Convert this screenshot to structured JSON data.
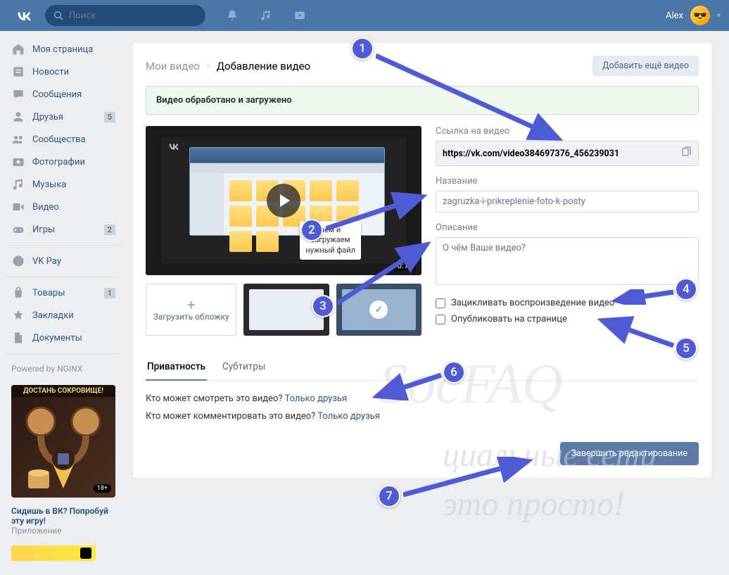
{
  "topbar": {
    "search_placeholder": "Поиск",
    "user": "Alex"
  },
  "nav": [
    {
      "icon": "home",
      "label": "Моя страница",
      "badge": ""
    },
    {
      "icon": "news",
      "label": "Новости",
      "badge": ""
    },
    {
      "icon": "msg",
      "label": "Сообщения",
      "badge": ""
    },
    {
      "icon": "friends",
      "label": "Друзья",
      "badge": "5"
    },
    {
      "icon": "groups",
      "label": "Сообщества",
      "badge": ""
    },
    {
      "icon": "photo",
      "label": "Фотографии",
      "badge": ""
    },
    {
      "icon": "music",
      "label": "Музыка",
      "badge": ""
    },
    {
      "icon": "video",
      "label": "Видео",
      "badge": ""
    },
    {
      "icon": "games",
      "label": "Игры",
      "badge": "2"
    }
  ],
  "nav2": [
    {
      "icon": "pay",
      "label": "VK Pay"
    }
  ],
  "nav3": [
    {
      "icon": "market",
      "label": "Товары",
      "badge": "1"
    },
    {
      "icon": "fav",
      "label": "Закладки",
      "badge": ""
    },
    {
      "icon": "doc",
      "label": "Документы",
      "badge": ""
    }
  ],
  "powered": "Powered by NGINX",
  "promo": {
    "head": "ДОСТАНЬ СОКРОВИЩЕ!",
    "age": "18+",
    "title": "Сидишь в ВК? Попробуй эту игру!",
    "sub": "Приложение"
  },
  "crumbs": {
    "root": "Мои видео",
    "cur": "Добавление видео"
  },
  "add_more": "Добавить ещё видео",
  "status": "Видео обработано и загружено",
  "preview": {
    "tooltip_l1": "аем и",
    "tooltip_l2": "загружаем",
    "tooltip_l3": "нужный файл",
    "duration": "0:11"
  },
  "upload_cover": "Загрузить обложку",
  "fields": {
    "link_label": "Ссылка на видео",
    "link_value": "https://vk.com/video384697376_456239031",
    "name_label": "Название",
    "name_value": "zagruzka-i-prikreplenie-foto-k-posty",
    "desc_label": "Описание",
    "desc_placeholder": "О чём Ваше видео?",
    "loop": "Зацикливать воспроизведение видео",
    "publish": "Опубликовать на странице"
  },
  "tabs": {
    "privacy": "Приватность",
    "subs": "Субтитры"
  },
  "privacy": {
    "view_q": "Кто может смотреть это видео? ",
    "view_a": "Только друзья",
    "comment_q": "Кто может комментировать это видео? ",
    "comment_a": "Только друзья"
  },
  "save": "Завершить редактирование",
  "watermark": {
    "l1": "циальные сети",
    "l2": "это просто!",
    "logo": "SocFAQ"
  },
  "annotations": [
    "1",
    "2",
    "3",
    "4",
    "5",
    "6",
    "7"
  ]
}
